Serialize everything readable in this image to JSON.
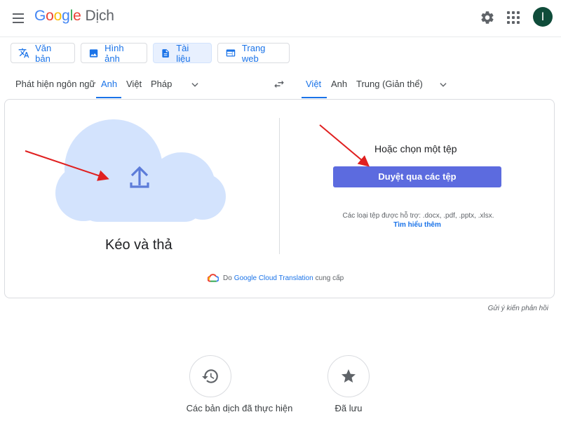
{
  "header": {
    "logo": [
      "G",
      "o",
      "o",
      "g",
      "l",
      "e"
    ],
    "product": "Dịch",
    "avatar_letter": "I"
  },
  "modes": [
    {
      "label": "Văn bản",
      "icon": "translate-icon"
    },
    {
      "label": "Hình ảnh",
      "icon": "image-icon"
    },
    {
      "label": "Tài liệu",
      "icon": "document-icon",
      "active": true
    },
    {
      "label": "Trang web",
      "icon": "web-icon"
    }
  ],
  "source_langs": [
    "Phát hiện ngôn ngữ",
    "Anh",
    "Việt",
    "Pháp"
  ],
  "target_langs": [
    "Việt",
    "Anh",
    "Trung (Giản thể)"
  ],
  "upload": {
    "drag_label": "Kéo và thả",
    "choose_label": "Hoặc chọn một tệp",
    "browse_label": "Duyệt qua các tệp",
    "supported_text": "Các loại tệp được hỗ trợ: .docx, .pdf, .pptx, .xlsx.",
    "learn_more": "Tìm hiểu thêm"
  },
  "powered": {
    "prefix": "Do",
    "link": "Google Cloud Translation",
    "suffix": "cung cấp"
  },
  "feedback": "Gửi ý kiến phản hồi",
  "bottom": {
    "history_label": "Các bản dịch đã thực hiện",
    "saved_label": "Đã lưu"
  },
  "colors": {
    "accent": "#1a73e8",
    "browse_button": "#5c6bdf",
    "cloud": "#d3e3fd",
    "arrow": "#e02020"
  }
}
